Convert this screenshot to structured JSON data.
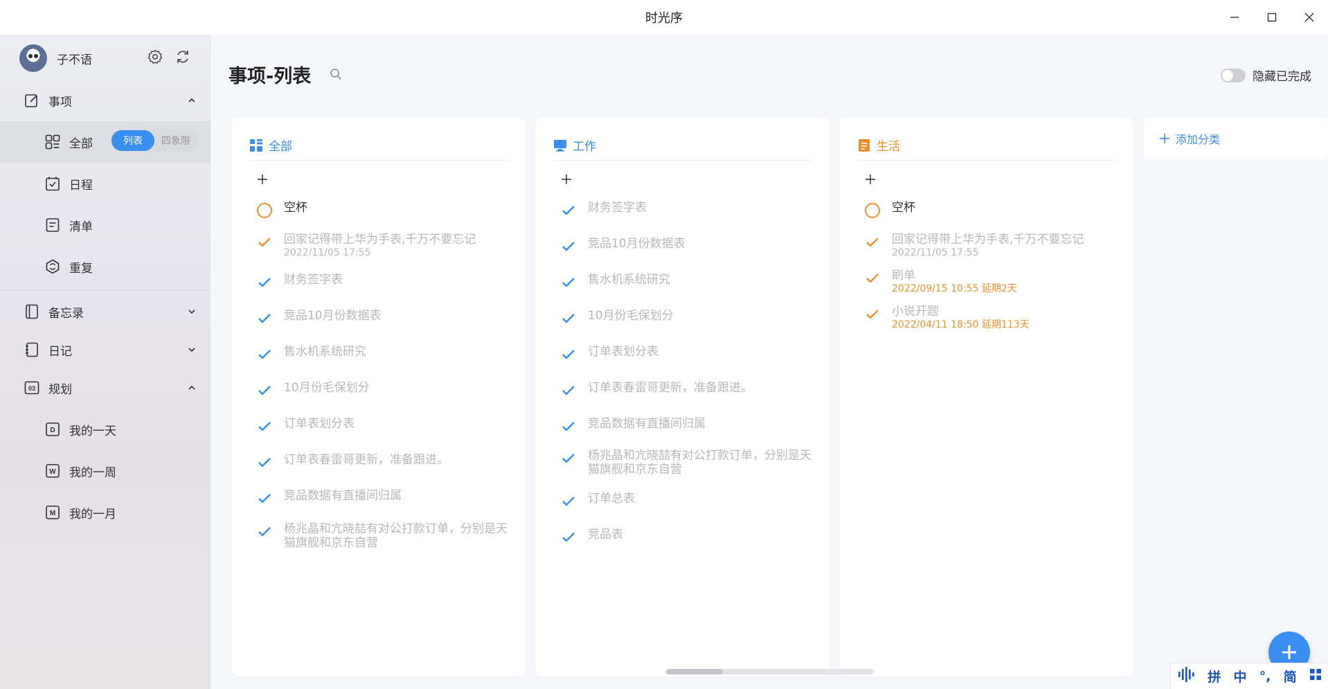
{
  "window": {
    "title": "时光序"
  },
  "sidebar": {
    "username": "子不语",
    "nav": {
      "matters": "事项",
      "all": "全部",
      "view_list": "列表",
      "view_quadrant": "四象限",
      "schedule": "日程",
      "checklist": "清单",
      "repeat": "重复",
      "memo": "备忘录",
      "diary": "日记",
      "planning": "规划",
      "my_day": "我的一天",
      "my_week": "我的一周",
      "my_month": "我的一月"
    }
  },
  "main": {
    "page_title": "事项-列表",
    "hide_done_label": "隐藏已完成",
    "hide_done_on": false,
    "add_category": "添加分类",
    "columns": [
      {
        "title": "全部",
        "color": "#3a8ef2",
        "tasks": [
          {
            "title": "空杯",
            "done": false
          },
          {
            "title": "回家记得带上华为手表,千万不要忘记",
            "sub": "2022/11/05 17:55",
            "done": true,
            "mark": "orange"
          },
          {
            "title": "财务签字表",
            "done": true,
            "mark": "blue"
          },
          {
            "title": "竞品10月份数据表",
            "done": true,
            "mark": "blue"
          },
          {
            "title": "售水机系统研究",
            "done": true,
            "mark": "blue"
          },
          {
            "title": "10月份毛保划分",
            "done": true,
            "mark": "blue"
          },
          {
            "title": "订单表划分表",
            "done": true,
            "mark": "blue"
          },
          {
            "title": "订单表春雷哥更新，准备跟进。",
            "done": true,
            "mark": "blue"
          },
          {
            "title": "竞品数据有直播间归属",
            "done": true,
            "mark": "blue"
          },
          {
            "title": "杨兆晶和亢晓喆有对公打款订单，分别是天猫旗舰和京东自营",
            "done": true,
            "mark": "blue"
          }
        ]
      },
      {
        "title": "工作",
        "color": "#3a8ef2",
        "tasks": [
          {
            "title": "财务签字表",
            "done": true,
            "mark": "blue"
          },
          {
            "title": "竞品10月份数据表",
            "done": true,
            "mark": "blue"
          },
          {
            "title": "售水机系统研究",
            "done": true,
            "mark": "blue"
          },
          {
            "title": "10月份毛保划分",
            "done": true,
            "mark": "blue"
          },
          {
            "title": "订单表划分表",
            "done": true,
            "mark": "blue"
          },
          {
            "title": "订单表春雷哥更新，准备跟进。",
            "done": true,
            "mark": "blue"
          },
          {
            "title": "竞品数据有直播间归属",
            "done": true,
            "mark": "blue"
          },
          {
            "title": "杨兆晶和亢晓喆有对公打款订单，分别是天猫旗舰和京东自营",
            "done": true,
            "mark": "blue"
          },
          {
            "title": "订单总表",
            "done": true,
            "mark": "blue"
          },
          {
            "title": "竞品表",
            "done": true,
            "mark": "blue"
          }
        ]
      },
      {
        "title": "生活",
        "color": "#f0902d",
        "tasks": [
          {
            "title": "空杯",
            "done": false
          },
          {
            "title": "回家记得带上华为手表,千万不要忘记",
            "sub": "2022/11/05 17:55",
            "done": true,
            "mark": "orange"
          },
          {
            "title": "刷单",
            "sub": "2022/09/15 10:55  延期2天",
            "sub_orange": true,
            "done": true,
            "mark": "orange"
          },
          {
            "title": "小说开题",
            "sub": "2022/04/11 18:50  延期113天",
            "sub_orange": true,
            "done": true,
            "mark": "orange"
          }
        ]
      }
    ]
  },
  "ime": {
    "items": [
      "拼",
      "中",
      "°,",
      "简"
    ]
  },
  "colors": {
    "accent": "#3a8ef2",
    "life": "#f0902d"
  }
}
